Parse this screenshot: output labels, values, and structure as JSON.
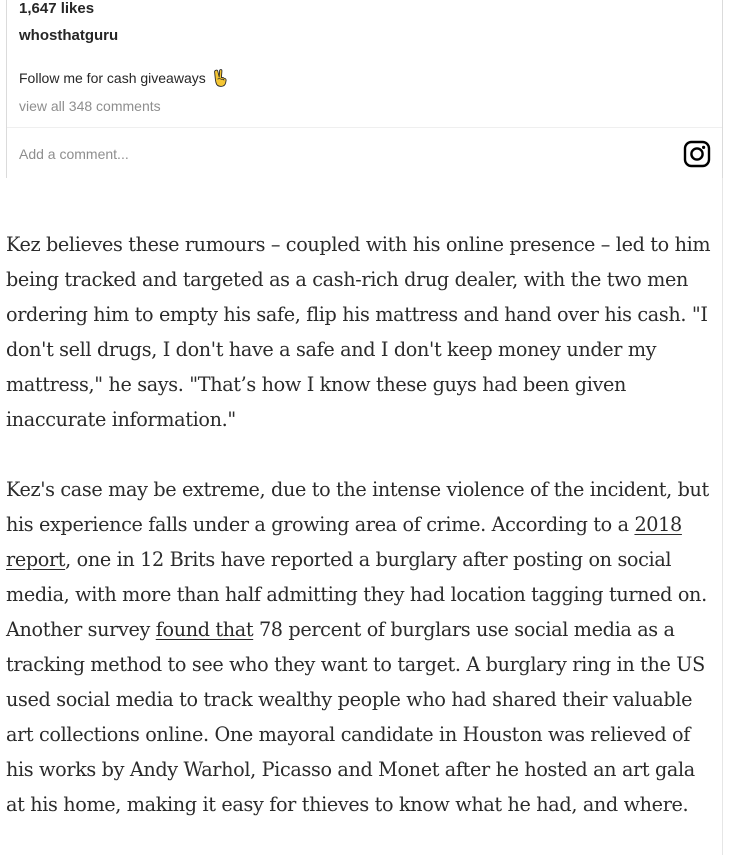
{
  "instagram_embed": {
    "likes": "1,647 likes",
    "username": "whosthatguru",
    "caption": "Follow me for cash giveaways",
    "caption_emoji": "victory-hand-emoji",
    "view_comments": "view all 348 comments",
    "comment_placeholder": "Add a comment...",
    "logo_icon": "instagram-icon"
  },
  "article": {
    "paragraph1": "Kez believes these rumours – coupled with his online presence – led to him being tracked and targeted as a cash-rich drug dealer, with the two men ordering him to empty his safe, flip his mattress and hand over his cash. \"I don't sell drugs, I don't have a safe and I don't keep money under my mattress,\" he says. \"That’s how I know these guys had been given inaccurate information.\"",
    "paragraph2": {
      "part1": "Kez's case may be extreme, due to the intense violence of the incident, but his experience falls under a growing area of crime. According to a ",
      "link1": "2018 report",
      "part2": ", one in 12 Brits have reported a burglary after posting on social media, with more than half admitting they had location tagging turned on. Another survey ",
      "link2": "found that",
      "part3": " 78 percent of burglars use social media as a tracking method to see who they want to target. A burglary ring in the US used social media to track wealthy people who had shared their valuable art collections online. One mayoral candidate in Houston was relieved of his works by Andy Warhol, Picasso and Monet after he hosted an art gala at his home, making it easy for thieves to know what he had, and where."
    }
  }
}
